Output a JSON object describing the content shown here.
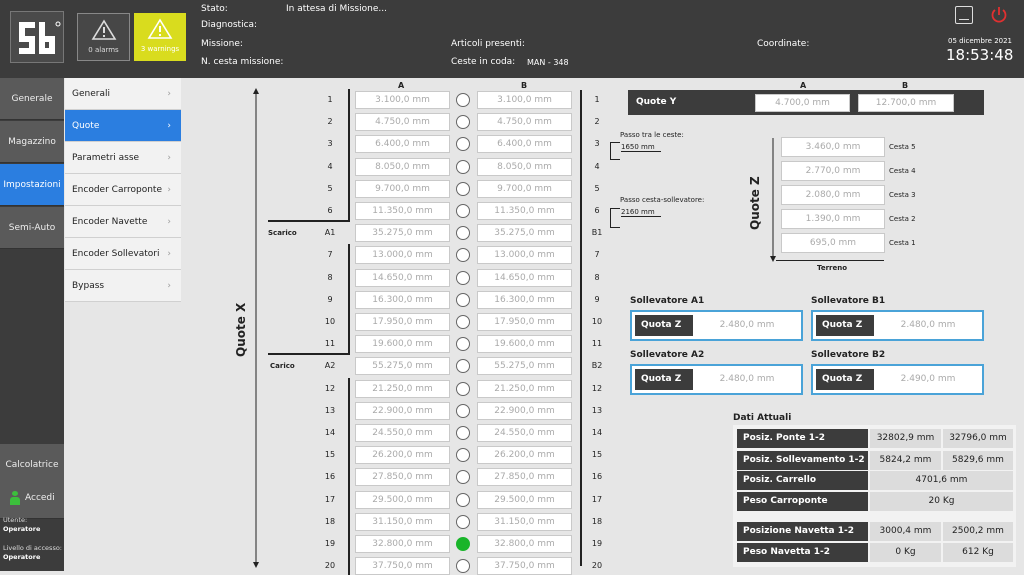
{
  "header": {
    "stato_label": "Stato:",
    "stato_value": "In attesa di Missione...",
    "diagnostica_label": "Diagnostica:",
    "missione_label": "Missione:",
    "cesta_label": "N. cesta missione:",
    "articoli_label": "Articoli presenti:",
    "coda_label": "Ceste in coda:",
    "coda_value": "MAN - 348",
    "coordinate_label": "Coordinate:",
    "date": "05 dicembre 2021",
    "time": "18:53:48",
    "alarms": "0 alarms",
    "warnings": "3 warnings",
    "alarm_icon": "warning-triangle-icon",
    "warning_icon": "warning-triangle-icon",
    "warning_color": "#d9dc1e",
    "power_color": "#e03030"
  },
  "sidebar": {
    "items": [
      "Generale",
      "Magazzino",
      "Impostazioni",
      "Semi-Auto"
    ],
    "calc": "Calcolatrice",
    "accedi": "Accedi",
    "utente_label": "Utente:",
    "utente_value": "Operatore",
    "livello_label": "Livello di accesso:",
    "livello_value": "Operatore"
  },
  "submenu": [
    "Generali",
    "Quote",
    "Parametri asse",
    "Encoder Carroponte",
    "Encoder Navette",
    "Encoder Sollevatori",
    "Bypass"
  ],
  "quote": {
    "col_a": "A",
    "col_b": "B",
    "axis_label": "Quote X",
    "scarico": "Scarico",
    "carico": "Carico",
    "rows": [
      {
        "l": "1",
        "a": "3.100,0 mm",
        "b": "3.100,0 mm",
        "r": "1"
      },
      {
        "l": "2",
        "a": "4.750,0 mm",
        "b": "4.750,0 mm",
        "r": "2"
      },
      {
        "l": "3",
        "a": "6.400,0 mm",
        "b": "6.400,0 mm",
        "r": "3"
      },
      {
        "l": "4",
        "a": "8.050,0 mm",
        "b": "8.050,0 mm",
        "r": "4"
      },
      {
        "l": "5",
        "a": "9.700,0 mm",
        "b": "9.700,0 mm",
        "r": "5"
      },
      {
        "l": "6",
        "a": "11.350,0 mm",
        "b": "11.350,0 mm",
        "r": "6"
      },
      {
        "l": "A1",
        "a": "35.275,0 mm",
        "b": "35.275,0 mm",
        "r": "B1"
      },
      {
        "l": "7",
        "a": "13.000,0 mm",
        "b": "13.000,0 mm",
        "r": "7"
      },
      {
        "l": "8",
        "a": "14.650,0 mm",
        "b": "14.650,0 mm",
        "r": "8"
      },
      {
        "l": "9",
        "a": "16.300,0 mm",
        "b": "16.300,0 mm",
        "r": "9"
      },
      {
        "l": "10",
        "a": "17.950,0 mm",
        "b": "17.950,0 mm",
        "r": "10"
      },
      {
        "l": "11",
        "a": "19.600,0 mm",
        "b": "19.600,0 mm",
        "r": "11"
      },
      {
        "l": "A2",
        "a": "55.275,0 mm",
        "b": "55.275,0 mm",
        "r": "B2"
      },
      {
        "l": "12",
        "a": "21.250,0 mm",
        "b": "21.250,0 mm",
        "r": "12"
      },
      {
        "l": "13",
        "a": "22.900,0 mm",
        "b": "22.900,0 mm",
        "r": "13"
      },
      {
        "l": "14",
        "a": "24.550,0 mm",
        "b": "24.550,0 mm",
        "r": "14"
      },
      {
        "l": "15",
        "a": "26.200,0 mm",
        "b": "26.200,0 mm",
        "r": "15"
      },
      {
        "l": "16",
        "a": "27.850,0 mm",
        "b": "27.850,0 mm",
        "r": "16"
      },
      {
        "l": "17",
        "a": "29.500,0 mm",
        "b": "29.500,0 mm",
        "r": "17"
      },
      {
        "l": "18",
        "a": "31.150,0 mm",
        "b": "31.150,0 mm",
        "r": "18"
      },
      {
        "l": "19",
        "a": "32.800,0 mm",
        "b": "32.800,0 mm",
        "r": "19",
        "active": true
      },
      {
        "l": "20",
        "a": "37.750,0 mm",
        "b": "37.750,0 mm",
        "r": "20"
      }
    ],
    "passo_ceste_label": "Passo tra le ceste:",
    "passo_ceste_value": "1650 mm",
    "passo_soll_label": "Passo cesta-sollevatore:",
    "passo_soll_value": "2160 mm"
  },
  "quote_y": {
    "label": "Quote Y",
    "col_a": "A",
    "col_b": "B",
    "a": "4.700,0 mm",
    "b": "12.700,0 mm"
  },
  "quote_z": {
    "label": "Quote Z",
    "terreno": "Terreno",
    "rows": [
      {
        "v": "3.460,0 mm",
        "n": "Cesta 5"
      },
      {
        "v": "2.770,0 mm",
        "n": "Cesta 4"
      },
      {
        "v": "2.080,0 mm",
        "n": "Cesta 3"
      },
      {
        "v": "1.390,0 mm",
        "n": "Cesta 2"
      },
      {
        "v": "695,0 mm",
        "n": "Cesta 1"
      }
    ]
  },
  "sollevatori": [
    {
      "title": "Sollevatore A1",
      "label": "Quota Z",
      "value": "2.480,0 mm"
    },
    {
      "title": "Sollevatore B1",
      "label": "Quota Z",
      "value": "2.480,0 mm"
    },
    {
      "title": "Sollevatore A2",
      "label": "Quota Z",
      "value": "2.480,0 mm"
    },
    {
      "title": "Sollevatore B2",
      "label": "Quota Z",
      "value": "2.490,0 mm"
    }
  ],
  "dati": {
    "title": "Dati Attuali",
    "rows": [
      {
        "k": "Posiz. Ponte 1-2",
        "v1": "32802,9 mm",
        "v2": "32796,0 mm"
      },
      {
        "k": "Posiz. Sollevamento 1-2",
        "v1": "5824,2 mm",
        "v2": "5829,6 mm"
      },
      {
        "k": "Posiz. Carrello",
        "v": "4701,6 mm"
      },
      {
        "k": "Peso Carroponte",
        "v": "20 Kg"
      },
      {
        "k": "Posizione Navetta 1-2",
        "v1": "3000,4 mm",
        "v2": "2500,2 mm"
      },
      {
        "k": "Peso Navetta 1-2",
        "v1": "0 Kg",
        "v2": "612 Kg"
      }
    ]
  }
}
